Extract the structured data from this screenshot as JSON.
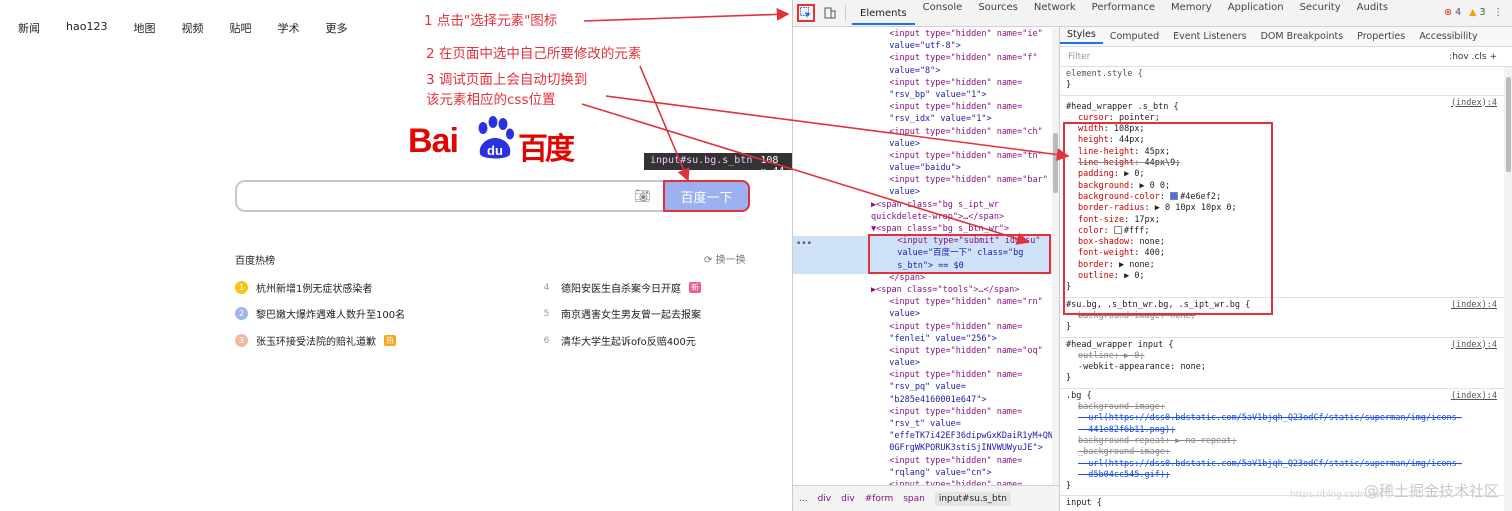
{
  "baidu": {
    "nav": [
      "新闻",
      "hao123",
      "地图",
      "视频",
      "贴吧",
      "学术",
      "更多"
    ],
    "logo_bai": "Bai",
    "logo_du": "du",
    "logo_cn": "百度",
    "tooltip_selector": "input#su.bg.s_btn",
    "tooltip_size": "108 × 44",
    "search_button": "百度一下",
    "hot_title": "百度热榜",
    "refresh": "换一换",
    "hot_left": [
      {
        "rank": "1",
        "text": "杭州新增1例无症状感染者",
        "color": "#f5c518"
      },
      {
        "rank": "2",
        "text": "黎巴嫩大爆炸遇难人数升至100名",
        "color": "#9fb7e6"
      },
      {
        "rank": "3",
        "text": "张玉环接受法院的赔礼道歉",
        "color": "#f2b9a0",
        "tag": "热"
      }
    ],
    "hot_right": [
      {
        "rank": "4",
        "text": "德阳安医生自杀案今日开庭",
        "tag": "新"
      },
      {
        "rank": "5",
        "text": "南京遇害女生男友曾一起去报案"
      },
      {
        "rank": "6",
        "text": "清华大学生起诉ofo反赔400元"
      }
    ]
  },
  "annotations": {
    "step1": "1 点击\"选择元素\"图标",
    "step2": "2 在页面中选中自己所要修改的元素",
    "step3a": "3 调试页面上会自动切换到",
    "step3b": "该元素相应的css位置"
  },
  "devtools": {
    "tabs": [
      "Elements",
      "Console",
      "Sources",
      "Network",
      "Performance",
      "Memory",
      "Application",
      "Security",
      "Audits"
    ],
    "errors": "4",
    "warnings": "3",
    "subtabs": [
      "Styles",
      "Computed",
      "Event Listeners",
      "DOM Breakpoints",
      "Properties",
      "Accessibility"
    ],
    "filter_placeholder": "Filter",
    "filter_right": ":hov  .cls  +",
    "breadcrumb": [
      "...",
      "div",
      "div",
      "#form",
      "span",
      "input#su.s_btn"
    ],
    "elements_lines": [
      "  <input type=\"hidden\" name=\"ie\"",
      "  value=\"utf-8\">",
      "  <input type=\"hidden\" name=\"f\"",
      "  value=\"8\">",
      "  <input type=\"hidden\" name=",
      "  \"rsv_bp\" value=\"1\">",
      "  <input type=\"hidden\" name=",
      "  \"rsv_idx\" value=\"1\">",
      "  <input type=\"hidden\" name=\"ch\"",
      "  value>",
      "  <input type=\"hidden\" name=\"tn\"",
      "  value=\"baidu\">",
      "  <input type=\"hidden\" name=\"bar\"",
      "  value>",
      "▶<span class=\"bg s_ipt_wr",
      "quickdelete-wrap\">…</span>",
      "▼<span class=\"bg s_btn_wr\">",
      "  <input type=\"submit\" id=\"su\"",
      "  value=\"百度一下\" class=\"bg",
      "  s_btn\"> == $0",
      "  </span>",
      "▶<span class=\"tools\">…</span>",
      "  <input type=\"hidden\" name=\"rn\"",
      "  value>",
      "  <input type=\"hidden\" name=",
      "  \"fenlei\" value=\"256\">",
      "  <input type=\"hidden\" name=\"oq\"",
      "  value>",
      "  <input type=\"hidden\" name=",
      "  \"rsv_pq\" value=",
      "  \"b285e4160001e647\">",
      "  <input type=\"hidden\" name=",
      "  \"rsv_t\" value=",
      "  \"effeTK7i42EF36dipwGxKDaiR1yM+QN",
      "  0GFrgWKPORUK3stiSjINVWUWyuJE\">",
      "  <input type=\"hidden\" name=",
      "  \"rqlang\" value=\"cn\">",
      "  <input type=\"hidden\" name="
    ],
    "element_style": "element.style {",
    "rule1_selector": "#head_wrapper .s_btn {",
    "rule1_src": "(index):4",
    "rule1_decls": [
      {
        "p": "cursor",
        "v": "pointer;"
      },
      {
        "p": "width",
        "v": "108px;"
      },
      {
        "p": "height",
        "v": "44px;"
      },
      {
        "p": "line-height",
        "v": "45px;"
      },
      {
        "p": "line-height",
        "v": "44px\\9;",
        "strike": true
      },
      {
        "p": "padding",
        "v": "▶ 0;"
      },
      {
        "p": "background",
        "v": "▶ 0 0;"
      },
      {
        "p": "background-color",
        "v": "#4e6ef2;",
        "sw": "#4e6ef2"
      },
      {
        "p": "border-radius",
        "v": "▶ 0 10px 10px 0;"
      },
      {
        "p": "font-size",
        "v": "17px;"
      },
      {
        "p": "color",
        "v": "#fff;",
        "sw": "#ffffff"
      },
      {
        "p": "box-shadow",
        "v": "none;"
      },
      {
        "p": "font-weight",
        "v": "400;"
      },
      {
        "p": "border",
        "v": "▶ none;"
      },
      {
        "p": "outline",
        "v": "▶ 0;"
      }
    ],
    "rule2_selector": "#su.bg, .s_btn_wr.bg, .s_ipt_wr.bg {",
    "rule2_decl": "background-image: none;",
    "rule3_selector": "#head_wrapper input {",
    "rule3_decls": [
      "outline: ▶ 0;",
      "-webkit-appearance: none;"
    ],
    "rule4_selector": ".bg {",
    "rule4_decls": [
      "background-image:",
      "  url(https://dss0.bdstatic.com/5aV1bjqh_Q23odCf/static/superman/img/icons-",
      "  441e82f6b11.png);",
      "background-repeat: ▶ no-repeat;",
      "_background-image:",
      "  url(https://dss0.bdstatic.com/5aV1bjqh_Q23odCf/static/superman/img/icons-",
      "  d5b04cc545.gif);"
    ],
    "rule5_selector": "input {",
    "watermark": "@稀土掘金技术社区",
    "watermark_small": "https://blog.csdn.net"
  }
}
